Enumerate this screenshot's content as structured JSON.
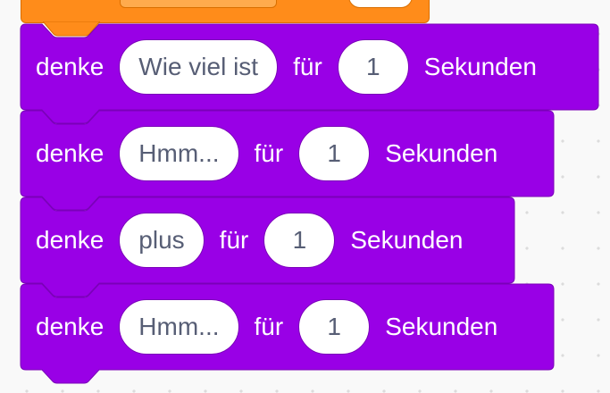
{
  "palette": {
    "looks_fill": "#9900e6",
    "looks_stroke": "#7a00b8",
    "events_fill": "#ff8c1a",
    "input_text": "#575e75"
  },
  "blocks": [
    {
      "keyword": "denke",
      "message": "Wie viel ist",
      "conjunction": "für",
      "seconds": "1",
      "unit": "Sekunden"
    },
    {
      "keyword": "denke",
      "message": "Hmm...",
      "conjunction": "für",
      "seconds": "1",
      "unit": "Sekunden"
    },
    {
      "keyword": "denke",
      "message": "plus",
      "conjunction": "für",
      "seconds": "1",
      "unit": "Sekunden"
    },
    {
      "keyword": "denke",
      "message": "Hmm...",
      "conjunction": "für",
      "seconds": "1",
      "unit": "Sekunden"
    }
  ]
}
